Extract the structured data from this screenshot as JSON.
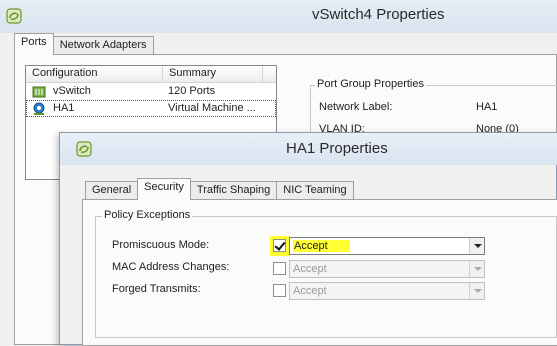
{
  "outer_window": {
    "title": "vSwitch4 Properties",
    "tabs": [
      {
        "label": "Ports",
        "active": true
      },
      {
        "label": "Network Adapters",
        "active": false
      }
    ],
    "port_list": {
      "columns": [
        "Configuration",
        "Summary"
      ],
      "rows": [
        {
          "name": "vSwitch",
          "summary": "120 Ports",
          "icon": "vswitch-icon"
        },
        {
          "name": "HA1",
          "summary": "Virtual Machine ...",
          "icon": "port-group-icon",
          "selected": true
        }
      ]
    },
    "port_group_properties": {
      "legend": "Port Group Properties",
      "network_label_label": "Network Label:",
      "network_label_value": "HA1",
      "vlan_id_label": "VLAN ID:",
      "vlan_id_value": "None (0)"
    }
  },
  "dialog": {
    "title": "HA1 Properties",
    "tabs": [
      {
        "label": "General",
        "active": false
      },
      {
        "label": "Security",
        "active": true
      },
      {
        "label": "Traffic Shaping",
        "active": false
      },
      {
        "label": "NIC Teaming",
        "active": false
      }
    ],
    "policy_exceptions": {
      "legend": "Policy Exceptions",
      "rows": [
        {
          "label": "Promiscuous Mode:",
          "checked": true,
          "value": "Accept",
          "enabled": true,
          "highlighted": true
        },
        {
          "label": "MAC Address Changes:",
          "checked": false,
          "value": "Accept",
          "enabled": false
        },
        {
          "label": "Forged Transmits:",
          "checked": false,
          "value": "Accept",
          "enabled": false
        }
      ]
    }
  },
  "colors": {
    "highlight": "#ffff33",
    "app_icon_green": "#6a9a1f"
  }
}
